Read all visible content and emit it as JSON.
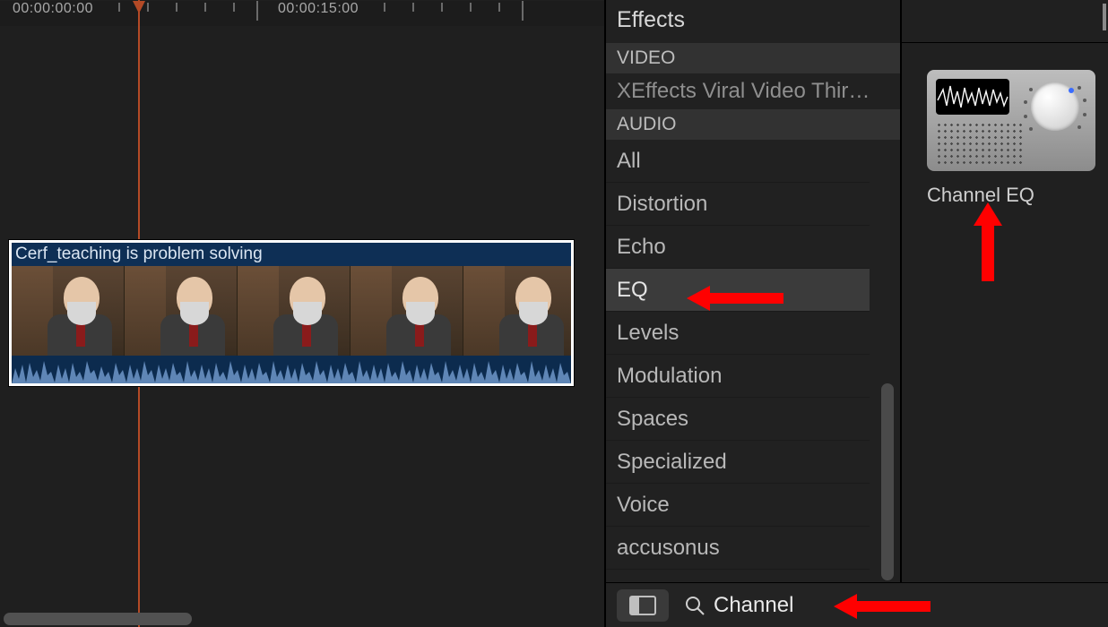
{
  "timeline": {
    "timecodes": [
      "00:00:00:00",
      "00:00:15:00"
    ],
    "clip_title": "Cerf_teaching is problem solving"
  },
  "effects": {
    "panel_title": "Effects",
    "video_header": "VIDEO",
    "video_truncated_item": "XEffects Viral Video Thir…",
    "audio_header": "AUDIO",
    "categories": [
      {
        "label": "All",
        "selected": false
      },
      {
        "label": "Distortion",
        "selected": false
      },
      {
        "label": "Echo",
        "selected": false
      },
      {
        "label": "EQ",
        "selected": true
      },
      {
        "label": "Levels",
        "selected": false
      },
      {
        "label": "Modulation",
        "selected": false
      },
      {
        "label": "Spaces",
        "selected": false
      },
      {
        "label": "Specialized",
        "selected": false
      },
      {
        "label": "Voice",
        "selected": false
      },
      {
        "label": "accusonus",
        "selected": false
      }
    ]
  },
  "preview": {
    "effect_name": "Channel EQ"
  },
  "search": {
    "value": "Channel"
  },
  "icons": {
    "layout": "layout-icon",
    "search": "search-icon",
    "waveform": "waveform-icon",
    "knob": "knob-icon"
  },
  "annotations": {
    "arrow_to_eq": true,
    "arrow_to_preview": true,
    "arrow_to_search": true
  }
}
